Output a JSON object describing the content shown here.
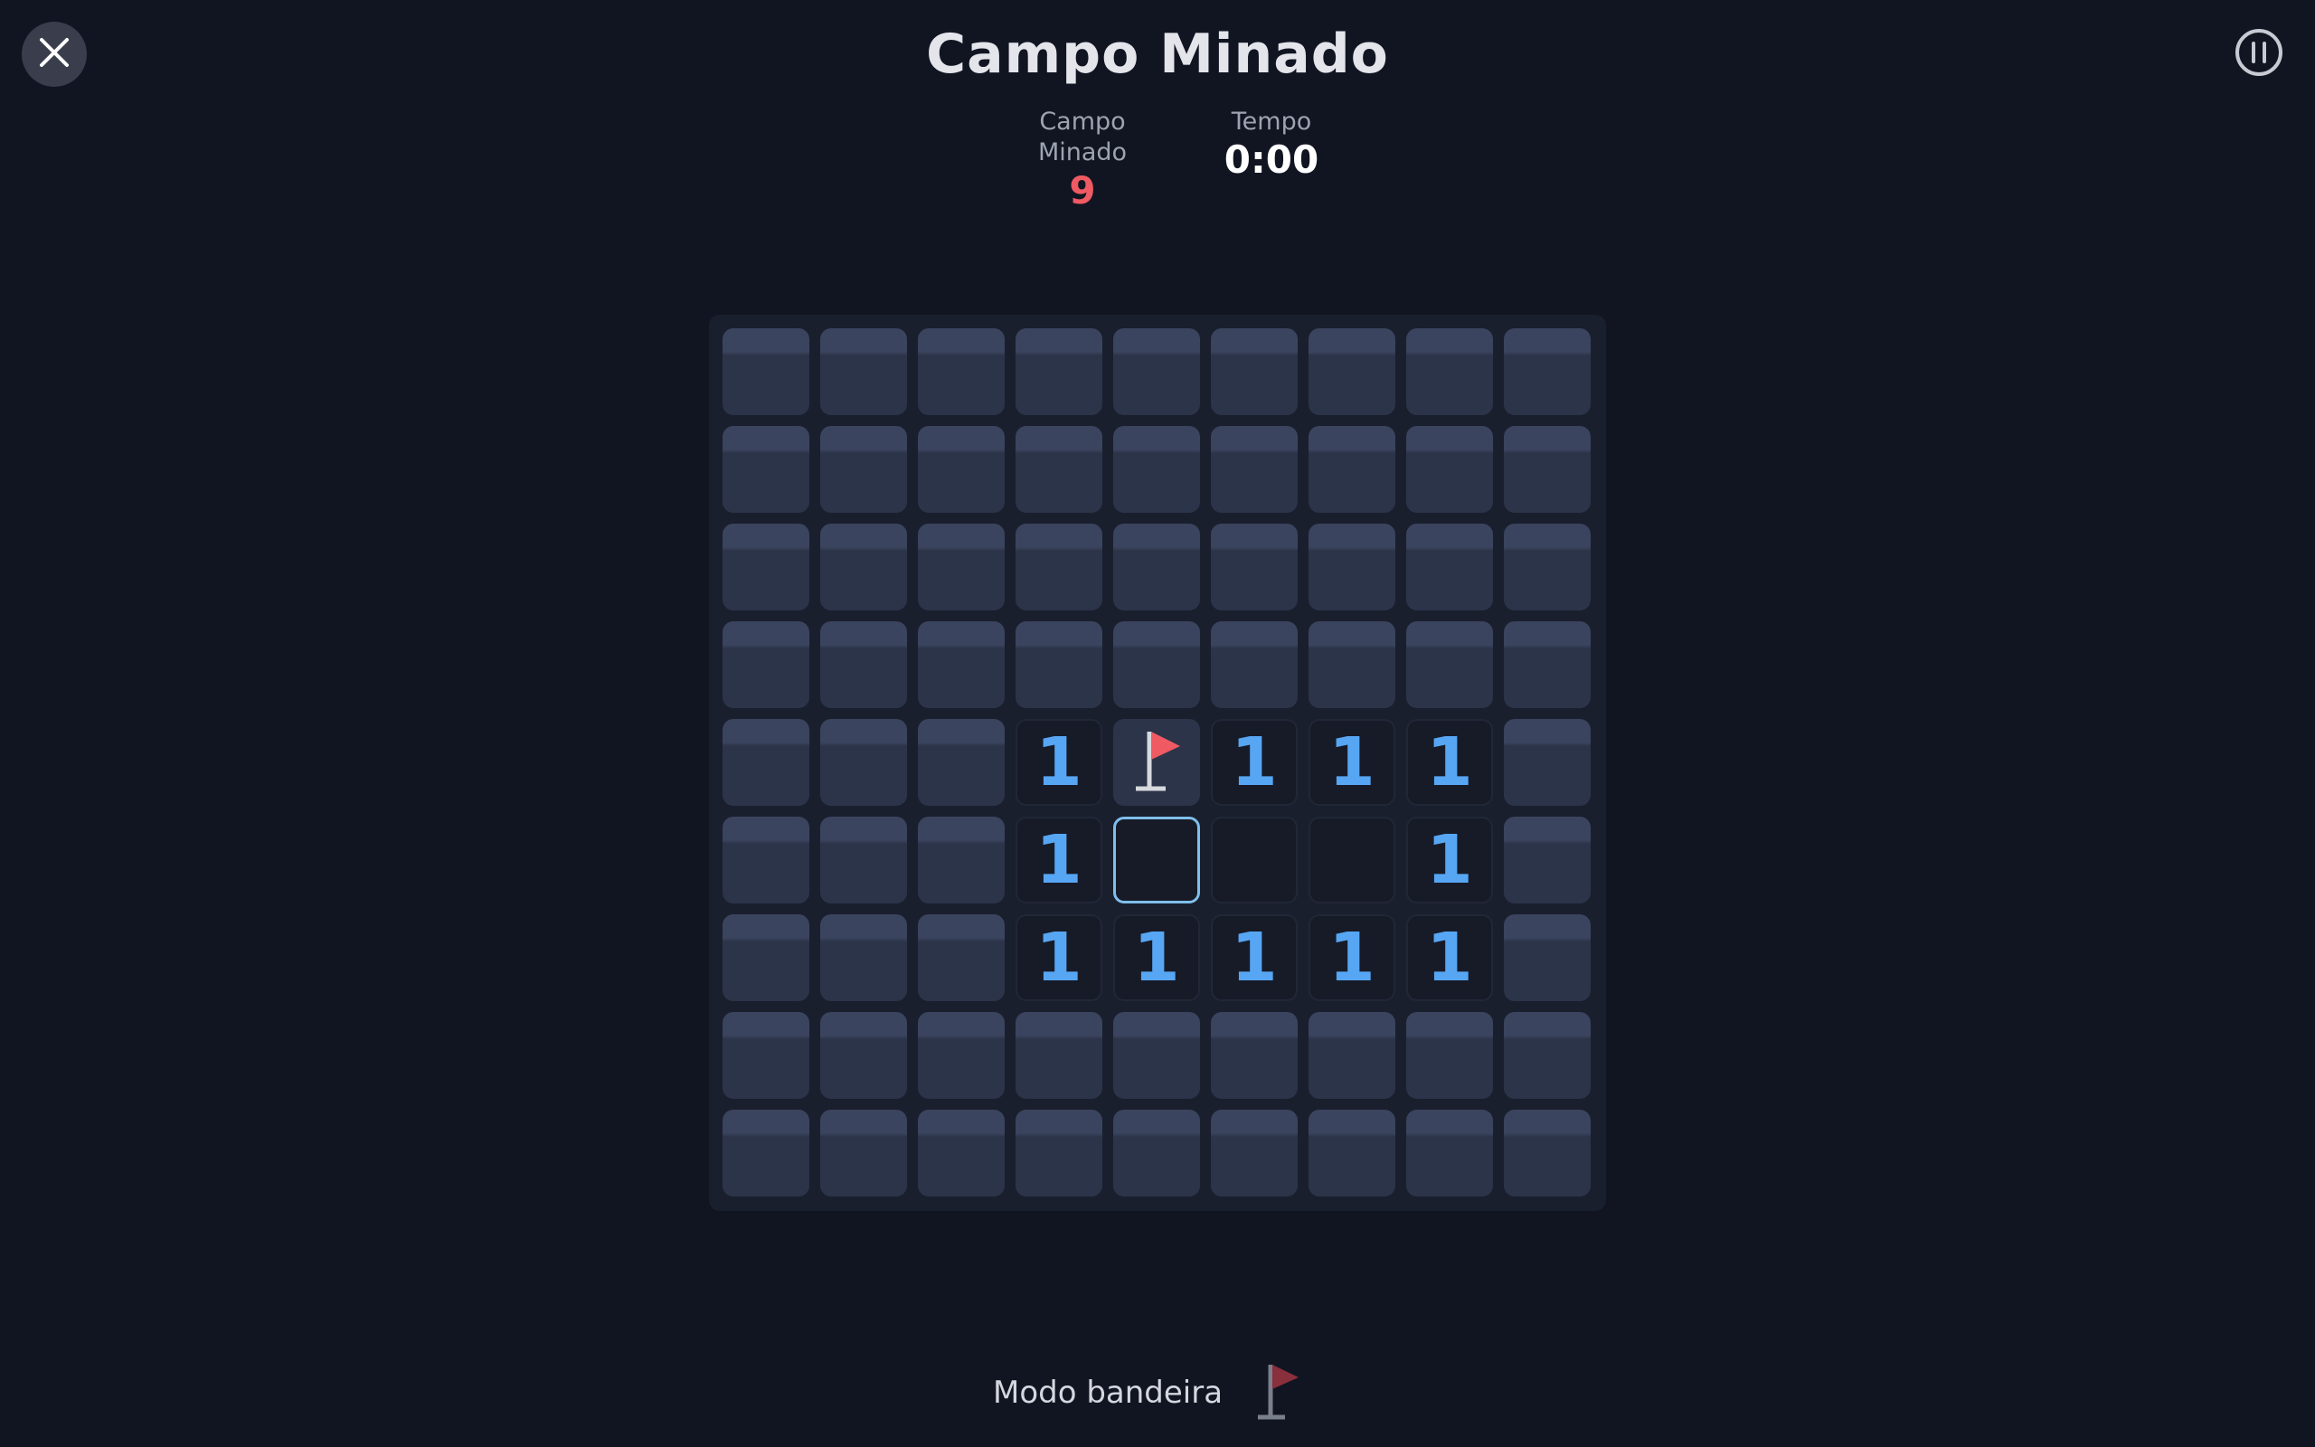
{
  "header": {
    "title": "Campo Minado",
    "mines_label": "Campo Minado",
    "mines_value": "9",
    "time_label": "Tempo",
    "time_value": "0:00"
  },
  "board": {
    "rows": 9,
    "cols": 9,
    "cells": [
      [
        "h",
        "h",
        "h",
        "h",
        "h",
        "h",
        "h",
        "h",
        "h"
      ],
      [
        "h",
        "h",
        "h",
        "h",
        "h",
        "h",
        "h",
        "h",
        "h"
      ],
      [
        "h",
        "h",
        "h",
        "h",
        "h",
        "h",
        "h",
        "h",
        "h"
      ],
      [
        "h",
        "h",
        "h",
        "h",
        "h",
        "h",
        "h",
        "h",
        "h"
      ],
      [
        "h",
        "h",
        "h",
        "1",
        "F",
        "1",
        "1",
        "1",
        "h"
      ],
      [
        "h",
        "h",
        "h",
        "1",
        "S",
        "0",
        "0",
        "1",
        "h"
      ],
      [
        "h",
        "h",
        "h",
        "1",
        "1",
        "1",
        "1",
        "1",
        "h"
      ],
      [
        "h",
        "h",
        "h",
        "h",
        "h",
        "h",
        "h",
        "h",
        "h"
      ],
      [
        "h",
        "h",
        "h",
        "h",
        "h",
        "h",
        "h",
        "h",
        "h"
      ]
    ]
  },
  "footer": {
    "flag_mode_label": "Modo bandeira",
    "flag_mode_icon": "flag-icon"
  },
  "colors": {
    "background": "#111522",
    "number": "#57a6f4",
    "mines_counter": "#ef5a63",
    "flag": "#ef5a63",
    "selected_border": "#7fbfeb"
  },
  "icons": {
    "close": "close-icon",
    "pause": "pause-icon"
  }
}
